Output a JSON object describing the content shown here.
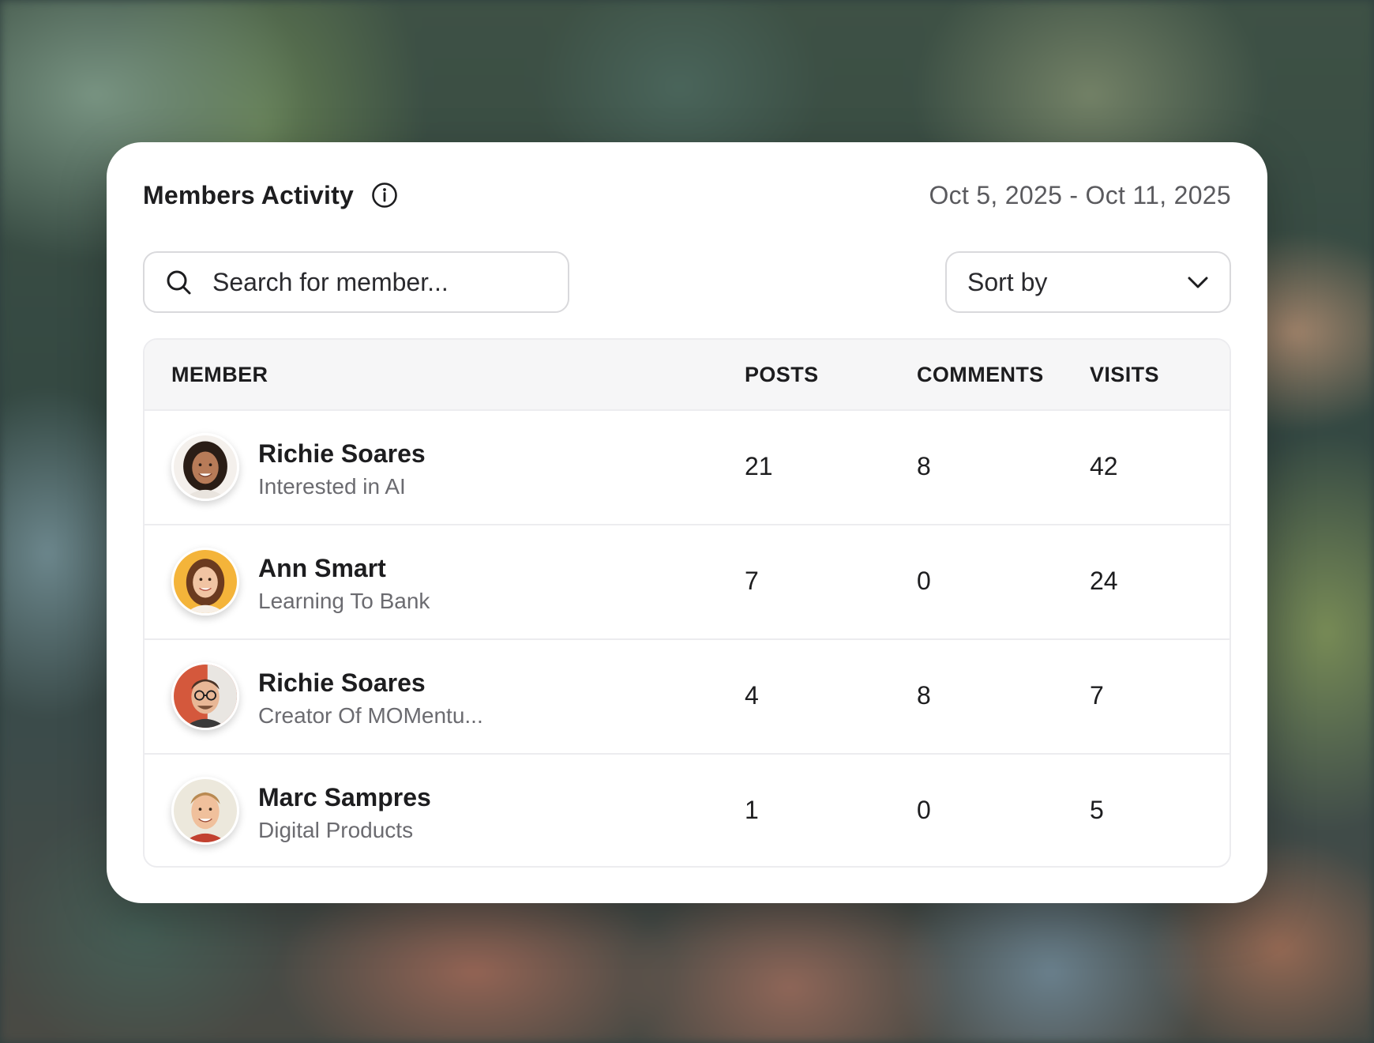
{
  "header": {
    "title": "Members Activity",
    "info_icon": "info-icon",
    "date_range": "Oct 5, 2025 - Oct 11, 2025"
  },
  "search": {
    "placeholder": "Search for member...",
    "value": "",
    "icon": "search-icon"
  },
  "sort": {
    "label": "Sort by",
    "icon": "chevron-down-icon"
  },
  "table": {
    "columns": [
      "MEMBER",
      "POSTS",
      "COMMENTS",
      "VISITS"
    ],
    "rows": [
      {
        "name": "Richie Soares",
        "subtitle": "Interested in AI",
        "posts": "21",
        "comments": "8",
        "visits": "42",
        "avatar": "avatar-woman-dark-hair"
      },
      {
        "name": "Ann Smart",
        "subtitle": "Learning To Bank",
        "posts": "7",
        "comments": "0",
        "visits": "24",
        "avatar": "avatar-woman-yellow-bg"
      },
      {
        "name": "Richie Soares",
        "subtitle": "Creator Of MOMentu...",
        "posts": "4",
        "comments": "8",
        "visits": "7",
        "avatar": "avatar-man-glasses"
      },
      {
        "name": "Marc Sampres",
        "subtitle": "Digital Products",
        "posts": "1",
        "comments": "0",
        "visits": "5",
        "avatar": "avatar-man-blond"
      }
    ]
  },
  "colors": {
    "card_bg": "#ffffff",
    "text_primary": "#1d1d1f",
    "text_secondary": "#6b6b70",
    "border": "#ececef",
    "header_bg": "#f6f6f7"
  }
}
